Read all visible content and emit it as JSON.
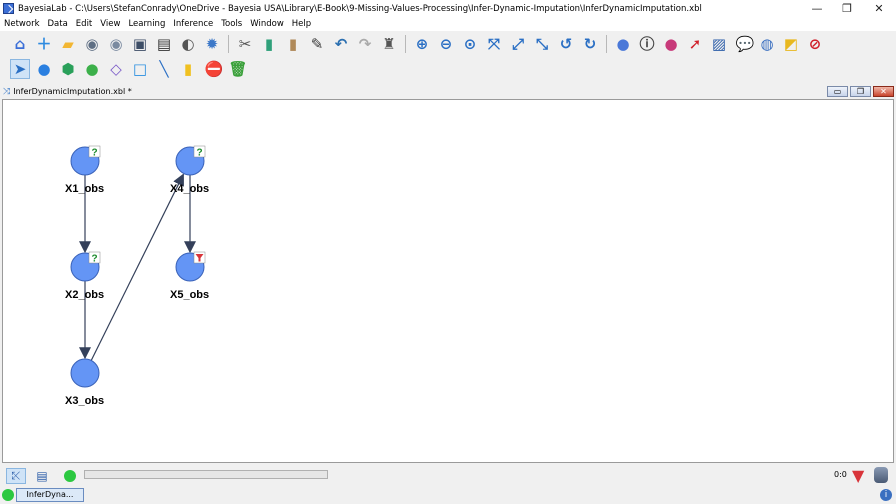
{
  "window": {
    "title": "BayesiaLab - C:\\Users\\StefanConrady\\OneDrive - Bayesia USA\\Library\\E-Book\\9-Missing-Values-Processing\\Infer-Dynamic-Imputation\\InferDynamicImputation.xbl",
    "minimize": "—",
    "restore": "❐",
    "close": "✕"
  },
  "menu": [
    "Network",
    "Data",
    "Edit",
    "View",
    "Learning",
    "Inference",
    "Tools",
    "Window",
    "Help"
  ],
  "toolbar1": [
    {
      "name": "home-icon",
      "glyph": "⌂",
      "color": "#3b6fd8"
    },
    {
      "name": "new-network-icon",
      "glyph": "＋",
      "color": "#2f8be0"
    },
    {
      "name": "open-folder-icon",
      "glyph": "▰",
      "color": "#f2b632"
    },
    {
      "name": "database-icon",
      "glyph": "◉",
      "color": "#5f6f84"
    },
    {
      "name": "database-associate-icon",
      "glyph": "◉",
      "color": "#7a8aa0"
    },
    {
      "name": "save-icon",
      "glyph": "▣",
      "color": "#3d4d66"
    },
    {
      "name": "print-icon",
      "glyph": "▤",
      "color": "#333"
    },
    {
      "name": "print-preview-icon",
      "glyph": "◐",
      "color": "#555"
    },
    {
      "name": "settings-gear-icon",
      "glyph": "✹",
      "color": "#3c78c8"
    },
    {
      "name": "sep"
    },
    {
      "name": "cut-icon",
      "glyph": "✂",
      "color": "#555"
    },
    {
      "name": "copy-icon",
      "glyph": "▮",
      "color": "#2fa07a"
    },
    {
      "name": "paste-icon",
      "glyph": "▮",
      "color": "#b08a5a"
    },
    {
      "name": "format-brush-icon",
      "glyph": "✎",
      "color": "#3a3a3a"
    },
    {
      "name": "undo-icon",
      "glyph": "↶",
      "color": "#2b6fb0"
    },
    {
      "name": "redo-icon",
      "glyph": "↷",
      "color": "#aaa"
    },
    {
      "name": "binoculars-icon",
      "glyph": "♜",
      "color": "#555"
    },
    {
      "name": "sep"
    },
    {
      "name": "zoom-in-icon",
      "glyph": "⊕",
      "color": "#2a6fc4"
    },
    {
      "name": "zoom-out-icon",
      "glyph": "⊖",
      "color": "#2a6fc4"
    },
    {
      "name": "zoom-fit-icon",
      "glyph": "⊙",
      "color": "#2a6fc4"
    },
    {
      "name": "fit-window-icon",
      "glyph": "⤧",
      "color": "#2a6fc4"
    },
    {
      "name": "expand-icon",
      "glyph": "⤢",
      "color": "#2a6fc4"
    },
    {
      "name": "shrink-icon",
      "glyph": "⤡",
      "color": "#2a6fc4"
    },
    {
      "name": "rotate-left-icon",
      "glyph": "↺",
      "color": "#2a6fc4"
    },
    {
      "name": "rotate-right-icon",
      "glyph": "↻",
      "color": "#2a6fc4"
    },
    {
      "name": "sep"
    },
    {
      "name": "node-style-icon",
      "glyph": "●",
      "color": "#4a78d8"
    },
    {
      "name": "node-info-icon",
      "glyph": "ⓘ",
      "color": "#444"
    },
    {
      "name": "node-color-icon",
      "glyph": "●",
      "color": "#c83a7a"
    },
    {
      "name": "arc-red-icon",
      "glyph": "➚",
      "color": "#d0202a"
    },
    {
      "name": "image-icon",
      "glyph": "▨",
      "color": "#2a5ca8"
    },
    {
      "name": "comment-icon",
      "glyph": "💬",
      "color": "#2aa08a"
    },
    {
      "name": "globe-info-icon",
      "glyph": "◍",
      "color": "#3a6fc0"
    },
    {
      "name": "note-icon",
      "glyph": "◩",
      "color": "#e8b820"
    },
    {
      "name": "forbidden-arc-icon",
      "glyph": "⊘",
      "color": "#d0202a"
    }
  ],
  "toolbar2": [
    {
      "name": "selection-arrow-icon",
      "glyph": "➤",
      "color": "#2a6fc4",
      "selected": true
    },
    {
      "name": "add-node-circle-icon",
      "glyph": "●",
      "color": "#2a7fe0"
    },
    {
      "name": "add-node-hexagon-icon",
      "glyph": "⬢",
      "color": "#2aa05a"
    },
    {
      "name": "add-constraint-node-icon",
      "glyph": "●",
      "color": "#3cb04a"
    },
    {
      "name": "add-decision-node-icon",
      "glyph": "◇",
      "color": "#7a5ac8"
    },
    {
      "name": "add-utility-node-icon",
      "glyph": "□",
      "color": "#2a8fe0"
    },
    {
      "name": "add-arc-icon",
      "glyph": "╲",
      "color": "#2a6fc4"
    },
    {
      "name": "add-note-icon",
      "glyph": "▮",
      "color": "#f0c020"
    },
    {
      "name": "stop-icon",
      "glyph": "⛔",
      "color": "#d0202a"
    },
    {
      "name": "delete-trash-icon",
      "glyph": "🗑",
      "color": "#3aa03a"
    }
  ],
  "document": {
    "title": "InferDynamicImputation.xbl *"
  },
  "nodes": [
    {
      "id": "X1_obs",
      "label": "X1_obs",
      "badge": "?",
      "badge_color": "#1a8a2a"
    },
    {
      "id": "X2_obs",
      "label": "X2_obs",
      "badge": "?",
      "badge_color": "#1a8a2a"
    },
    {
      "id": "X3_obs",
      "label": "X3_obs",
      "badge": "",
      "badge_color": ""
    },
    {
      "id": "X4_obs",
      "label": "X4_obs",
      "badge": "?",
      "badge_color": "#1a8a2a"
    },
    {
      "id": "X5_obs",
      "label": "X5_obs",
      "badge": "filter",
      "badge_color": "#d8343a"
    }
  ],
  "arcs": [
    {
      "from": "X1_obs",
      "to": "X2_obs"
    },
    {
      "from": "X2_obs",
      "to": "X3_obs"
    },
    {
      "from": "X3_obs",
      "to": "X4_obs"
    },
    {
      "from": "X4_obs",
      "to": "X5_obs"
    }
  ],
  "colors": {
    "node_fill": "#6495f5",
    "node_stroke": "#3a62b8",
    "arc": "#34405a"
  },
  "status": {
    "counter": "0:0"
  },
  "taskbar": {
    "item": "InferDyna..."
  }
}
